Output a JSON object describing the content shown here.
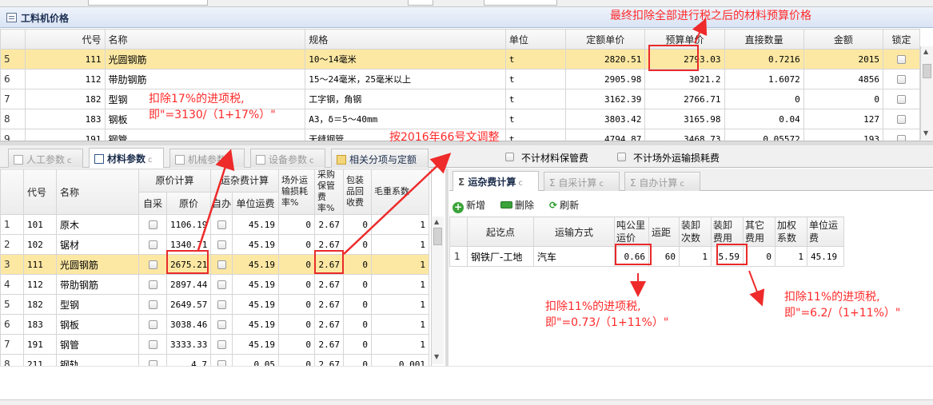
{
  "panel_title": "工料机价格",
  "top_table": {
    "headers": [
      "代号",
      "名称",
      "规格",
      "单位",
      "定额单价",
      "预算单价",
      "直接数量",
      "金额",
      "锁定"
    ],
    "rows": [
      {
        "n": "5",
        "code": "111",
        "name": "光圆钢筋",
        "spec": "10～14毫米",
        "unit": "t",
        "quota": "2820.51",
        "budget": "2793.03",
        "qty": "0.7216",
        "amount": "2015"
      },
      {
        "n": "6",
        "code": "112",
        "name": "带肋钢筋",
        "spec": "15～24毫米，25毫米以上",
        "unit": "t",
        "quota": "2905.98",
        "budget": "3021.2",
        "qty": "1.6072",
        "amount": "4856"
      },
      {
        "n": "7",
        "code": "182",
        "name": "型钢",
        "spec": "工字钢，角钢",
        "unit": "t",
        "quota": "3162.39",
        "budget": "2766.71",
        "qty": "0",
        "amount": "0"
      },
      {
        "n": "8",
        "code": "183",
        "name": "钢板",
        "spec": "A3，δ＝5～40mm",
        "unit": "t",
        "quota": "3803.42",
        "budget": "3165.98",
        "qty": "0.04",
        "amount": "127"
      },
      {
        "n": "9",
        "code": "191",
        "name": "钢管",
        "spec": "无缝钢管",
        "unit": "t",
        "quota": "4794.87",
        "budget": "3468.73",
        "qty": "0.05572",
        "amount": "193"
      }
    ]
  },
  "tabs": [
    "人工参数",
    "材料参数",
    "机械参数",
    "设备参数",
    "相关分项与定额"
  ],
  "tab_cc": "c",
  "checks": [
    "不计材料保管费",
    "不计场外运输损耗费"
  ],
  "left_table": {
    "group_headers": [
      "代号",
      "名称",
      "原价计算",
      "运杂费计算",
      "场外运输损耗率%",
      "采购保管费率%",
      "包装品回收费",
      "毛重系数"
    ],
    "sub_headers": [
      "自采",
      "原价",
      "自办",
      "单位运费"
    ],
    "rows": [
      {
        "n": "1",
        "code": "101",
        "name": "原木",
        "price": "1106.19",
        "freight": "45.19",
        "loss": "0",
        "keep": "2.67",
        "pack": "0",
        "w": "1"
      },
      {
        "n": "2",
        "code": "102",
        "name": "锯材",
        "price": "1340.71",
        "freight": "45.19",
        "loss": "0",
        "keep": "2.67",
        "pack": "0",
        "w": "1"
      },
      {
        "n": "3",
        "code": "111",
        "name": "光圆钢筋",
        "price": "2675.21",
        "freight": "45.19",
        "loss": "0",
        "keep": "2.67",
        "pack": "0",
        "w": "1"
      },
      {
        "n": "4",
        "code": "112",
        "name": "带肋钢筋",
        "price": "2897.44",
        "freight": "45.19",
        "loss": "0",
        "keep": "2.67",
        "pack": "0",
        "w": "1"
      },
      {
        "n": "5",
        "code": "182",
        "name": "型钢",
        "price": "2649.57",
        "freight": "45.19",
        "loss": "0",
        "keep": "2.67",
        "pack": "0",
        "w": "1"
      },
      {
        "n": "6",
        "code": "183",
        "name": "钢板",
        "price": "3038.46",
        "freight": "45.19",
        "loss": "0",
        "keep": "2.67",
        "pack": "0",
        "w": "1"
      },
      {
        "n": "7",
        "code": "191",
        "name": "钢管",
        "price": "3333.33",
        "freight": "45.19",
        "loss": "0",
        "keep": "2.67",
        "pack": "0",
        "w": "1"
      },
      {
        "n": "8",
        "code": "211",
        "name": "钢轨",
        "price": "4.7",
        "freight": "0.05",
        "loss": "0",
        "keep": "2.67",
        "pack": "0",
        "w": "0.001"
      }
    ]
  },
  "right_tabs": [
    "运杂费计算",
    "自采计算",
    "自办计算"
  ],
  "right_tab_prefix": "Σ",
  "buttons": {
    "add": "新增",
    "delete": "删除",
    "refresh": "刷新"
  },
  "right_table": {
    "headers": [
      "起讫点",
      "运输方式",
      "吨公里运价",
      "运距",
      "装卸次数",
      "装卸费用",
      "其它费用",
      "加权系数",
      "单位运费"
    ],
    "row": {
      "n": "1",
      "route": "钢铁厂-工地",
      "mode": "汽车",
      "rate": "0.66",
      "dist": "60",
      "times": "1",
      "fee": "5.59",
      "other": "0",
      "weight": "1",
      "unit_fee": "45.19"
    }
  },
  "annotations": {
    "top": "最终扣除全部进行税之后的材料预算价格",
    "left1": "扣除17%的进项税,",
    "left2": "即\"=3130/（1+17%）\"",
    "mid": "按2016年66号文调整",
    "r1a": "扣除11%的进项税,",
    "r1b": "即\"=0.73/（1+11%）\"",
    "r2a": "扣除11%的进项税,",
    "r2b": "即\"=6.2/（1+11%）\""
  }
}
